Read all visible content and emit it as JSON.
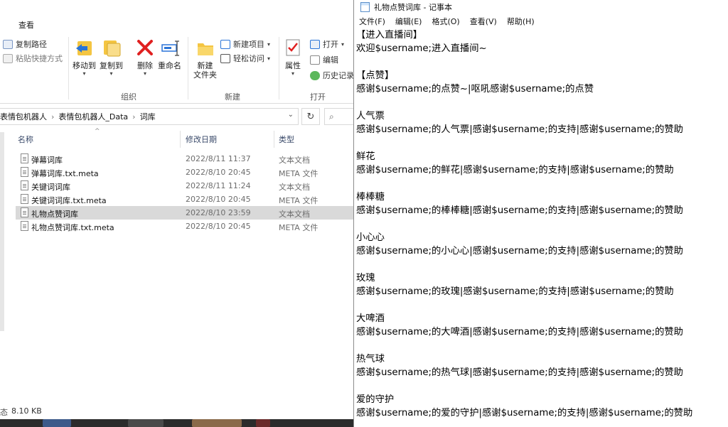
{
  "explorer": {
    "ribbon_tab": "查看",
    "clipboard": {
      "copy_path": "复制路径",
      "paste_shortcut": "粘贴快捷方式"
    },
    "organize": {
      "move_to": "移动到",
      "copy_to": "复制到",
      "delete": "删除",
      "rename": "重命名",
      "group_label": "组织"
    },
    "new": {
      "new_folder": "新建\n文件夹",
      "new_folder_l1": "新建",
      "new_folder_l2": "文件夹",
      "new_item": "新建项目",
      "easy_access": "轻松访问",
      "group_label": "新建"
    },
    "open": {
      "properties": "属性",
      "open": "打开",
      "edit": "编辑",
      "history": "历史记录",
      "group_label": "打开"
    },
    "breadcrumb": [
      "表情包机器人",
      "表情包机器人_Data",
      "词库"
    ],
    "columns": {
      "name": "名称",
      "modified": "修改日期",
      "type": "类型"
    },
    "files": [
      {
        "name": "弹幕词库",
        "modified": "2022/8/11 11:37",
        "type": "文本文档"
      },
      {
        "name": "弹幕词库.txt.meta",
        "modified": "2022/8/10 20:45",
        "type": "META 文件"
      },
      {
        "name": "关键词词库",
        "modified": "2022/8/11 11:24",
        "type": "文本文档"
      },
      {
        "name": "关键词词库.txt.meta",
        "modified": "2022/8/10 20:45",
        "type": "META 文件"
      },
      {
        "name": "礼物点赞词库",
        "modified": "2022/8/10 23:59",
        "type": "文本文档"
      },
      {
        "name": "礼物点赞词库.txt.meta",
        "modified": "2022/8/10 20:45",
        "type": "META 文件"
      }
    ],
    "selected_index": 4,
    "status": {
      "prefix": "态",
      "size": "8.10 KB"
    }
  },
  "notepad": {
    "title": "礼物点赞词库 - 记事本",
    "menu": [
      "文件(F)",
      "编辑(E)",
      "格式(O)",
      "查看(V)",
      "帮助(H)"
    ],
    "lines": [
      "【进入直播间】",
      "欢迎$username;进入直播间~",
      "",
      "【点赞】",
      "感谢$username;的点赞~|呕吼感谢$username;的点赞",
      "",
      "人气票",
      "感谢$username;的人气票|感谢$username;的支持|感谢$username;的赞助",
      "",
      "鲜花",
      "感谢$username;的鲜花|感谢$username;的支持|感谢$username;的赞助",
      "",
      "棒棒糖",
      "感谢$username;的棒棒糖|感谢$username;的支持|感谢$username;的赞助",
      "",
      "小心心",
      "感谢$username;的小心心|感谢$username;的支持|感谢$username;的赞助",
      "",
      "玫瑰",
      "感谢$username;的玫瑰|感谢$username;的支持|感谢$username;的赞助",
      "",
      "大啤酒",
      "感谢$username;的大啤酒|感谢$username;的支持|感谢$username;的赞助",
      "",
      "热气球",
      "感谢$username;的热气球|感谢$username;的支持|感谢$username;的赞助",
      "",
      "爱的守护",
      "感谢$username;的爱的守护|感谢$username;的支持|感谢$username;的赞助"
    ]
  },
  "colors": {
    "selection": "#d9d9d9",
    "delete_red": "#e02020",
    "folder_yellow": "#f4c542",
    "accent_blue": "#2a74d8"
  }
}
